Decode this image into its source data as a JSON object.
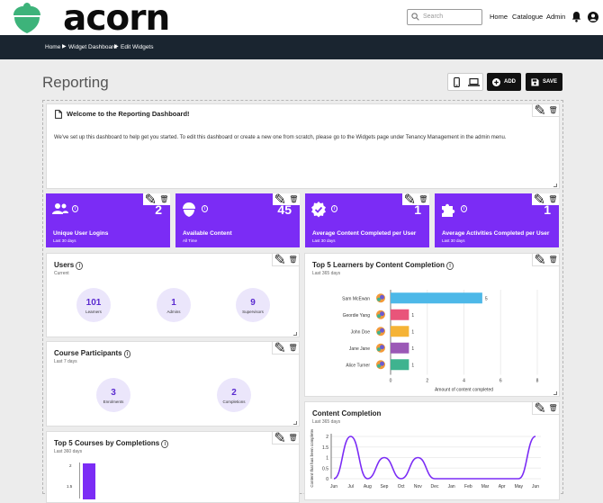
{
  "header": {
    "logo_text": "acorn",
    "search_placeholder": "Search",
    "nav": [
      "Home",
      "Catalogue",
      "Admin"
    ]
  },
  "breadcrumb": [
    "Home",
    "Widget Dashboard",
    "Edit Widgets"
  ],
  "page": {
    "title": "Reporting",
    "add_label": "ADD",
    "save_label": "SAVE"
  },
  "welcome": {
    "title": "Welcome to the Reporting Dashboard!",
    "body": "We've set up this dashboard to help get you started. To edit this dashboard or create a new one from scratch, please go to the Widgets page under Tenancy Management in the admin menu."
  },
  "tiles": [
    {
      "value": "2",
      "label": "Unique User Logins",
      "sub": "Last 30 days",
      "icon": "users-icon"
    },
    {
      "value": "45",
      "label": "Available Content",
      "sub": "All Time",
      "icon": "acorn-icon"
    },
    {
      "value": "1",
      "label": "Average Content Completed per User",
      "sub": "Last 30 days",
      "icon": "badge-check-icon"
    },
    {
      "value": "1",
      "label": "Average Activities Completed per User",
      "sub": "Last 30 days",
      "icon": "puzzle-icon"
    }
  ],
  "users": {
    "title": "Users",
    "sub": "Current",
    "stats": [
      {
        "value": "101",
        "label": "Learners"
      },
      {
        "value": "1",
        "label": "Admins"
      },
      {
        "value": "9",
        "label": "Supervisors"
      }
    ]
  },
  "participants": {
    "title": "Course Participants",
    "sub": "Last 7 days",
    "stats": [
      {
        "value": "3",
        "label": "Enrolments"
      },
      {
        "value": "2",
        "label": "Completions"
      }
    ]
  },
  "top_courses": {
    "title": "Top 5 Courses by Completions",
    "sub": "Last 360 days",
    "y_ticks": [
      "2",
      "1.5"
    ]
  },
  "chart_data": [
    {
      "type": "bar",
      "title": "Top 5 Learners by Content Completion",
      "subtitle": "Last 365 days",
      "orientation": "horizontal",
      "categories": [
        "Sam McEwan",
        "Geordie Yang",
        "John Doe",
        "Jane Jane",
        "Alice Turner"
      ],
      "values": [
        5,
        1,
        1,
        1,
        1
      ],
      "colors": [
        "#4db8e8",
        "#e9557a",
        "#f5b335",
        "#9b59b6",
        "#3fb38f"
      ],
      "xlabel": "Amount of content completed",
      "xlim": [
        0,
        8
      ],
      "x_ticks": [
        "0",
        "2",
        "4",
        "6",
        "8"
      ]
    },
    {
      "type": "line",
      "title": "Content Completion",
      "subtitle": "Last 365 days",
      "ylabel": "Content that has been completed",
      "x": [
        "Jun",
        "Jul",
        "Aug",
        "Sep",
        "Oct",
        "Nov",
        "Dec",
        "Jan",
        "Feb",
        "Mar",
        "Apr",
        "May",
        "Jun"
      ],
      "values": [
        0,
        2,
        0,
        1,
        0,
        1,
        0,
        0,
        0,
        0,
        0,
        0,
        2
      ],
      "ylim": [
        0,
        2
      ],
      "y_ticks": [
        "0",
        "0.5",
        "1",
        "1.5",
        "2"
      ],
      "color": "#7b2cf5"
    }
  ]
}
